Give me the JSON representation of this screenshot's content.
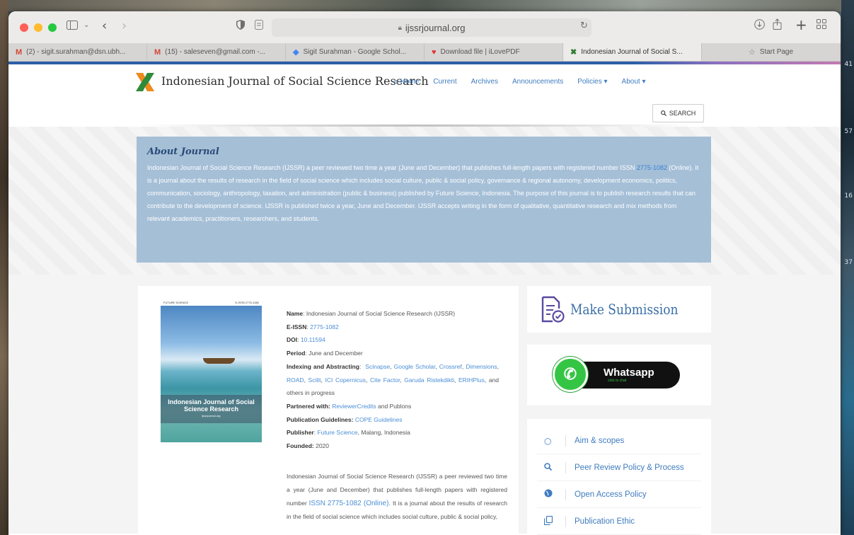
{
  "browser": {
    "url": "ijssrjournal.org",
    "tabs": [
      {
        "label": "(2) - sigit.surahman@dsn.ubh...",
        "favicon": "gmail-icon"
      },
      {
        "label": "(15) - saleseven@gmail.com -...",
        "favicon": "gmail-icon"
      },
      {
        "label": "Sigit Surahman - Google Schol...",
        "favicon": "google-scholar-icon"
      },
      {
        "label": "Download file | iLovePDF",
        "favicon": "ilovepdf-icon"
      },
      {
        "label": "Indonesian Journal of Social S...",
        "favicon": "ijssr-icon"
      },
      {
        "label": "Start Page",
        "favicon": "star-icon"
      }
    ],
    "desktop_numbers": [
      "41",
      "57",
      "16",
      "37"
    ]
  },
  "site": {
    "title": "Indonesian Journal of Social Science Research",
    "nav": {
      "home": "Home",
      "current": "Current",
      "archives": "Archives",
      "announcements": "Announcements",
      "policies": "Policies",
      "about": "About"
    },
    "search_label": "SEARCH"
  },
  "about": {
    "heading": "About Journal",
    "text_before_issn": "Indonesian Journal of Social Science Research (IJSSR) a peer reviewed two time a year (June and December) that publishes full-length papers with registered number ISSN ",
    "issn_link": "2775-1082",
    "text_after_issn": " (Online). It is a journal about the results of research in the field of social science which includes social culture, public & social policy, governance & regional autonomy, development economics, politics, communication, sociology, anthropology, taxation, and administration (public & business) published by Future Science, Indonesia. The purpose of this journal is to publish research results that can contribute to the development of science. IJSSR is published twice a year, June and December. IJSSR accepts writing in the form of qualitative, quantitative research and mix methods from relevant academics, practitioners, researchers, and students."
  },
  "cover": {
    "publisher_tag": "FUTURE SCIENCE",
    "eissn_tag": "E-ISSN 2775-1082",
    "title": "Indonesian Journal of Social Science Research",
    "site": "ijssrjournal.org"
  },
  "meta": {
    "name_label": "Name",
    "name_value": "Indonesian Journal of Social Science Research (IJSSR)",
    "eissn_label": "E-ISSN",
    "eissn_value": "2775-1082",
    "doi_label": "DOI",
    "doi_value": "10.11594",
    "period_label": "Period",
    "period_value": "June and December",
    "indexing_label": "Indexing and Abstracting",
    "indexing_links": [
      "Scinapse",
      "Google Scholar",
      "Crossref",
      "Dimensions",
      "ROAD",
      "Scilit",
      "ICI Copernicus",
      "Cite Factor",
      "Garuda Ristekdikti",
      "ERIHPlus"
    ],
    "indexing_tail": "and others in progress",
    "partnered_label": "Partnered with:",
    "partnered_link": "ReviewerCredits",
    "partnered_tail": "and Publons",
    "guidelines_label": "Publication Guidelines:",
    "guidelines_link": "COPE Guidelines",
    "publisher_label": "Publisher",
    "publisher_link": "Future Science",
    "publisher_tail": ", Malang, Indonesia",
    "founded_label": "Founded:",
    "founded_value": "2020"
  },
  "description": {
    "before_issn": "Indonesian Journal of Social Science Research (IJSSR) a peer reviewed two time a year (June and December) that publishes full-length papers with registered number ",
    "issn_word": "ISSN",
    "issn_number": "2775-1082 (Online).",
    "after_issn": " It is a journal about the results of research in the field of social science which includes social culture, public & social policy,"
  },
  "sidebar": {
    "make_submission": "Make Submission",
    "whatsapp_label": "Whatsapp",
    "whatsapp_sub": "click to chat",
    "policies": [
      {
        "label": "Aim & scopes",
        "icon": "circle-icon"
      },
      {
        "label": "Peer Review Policy  & Process",
        "icon": "search-icon"
      },
      {
        "label": "Open Access Policy",
        "icon": "globe-icon"
      },
      {
        "label": "Publication Ethic",
        "icon": "copy-icon"
      }
    ]
  }
}
